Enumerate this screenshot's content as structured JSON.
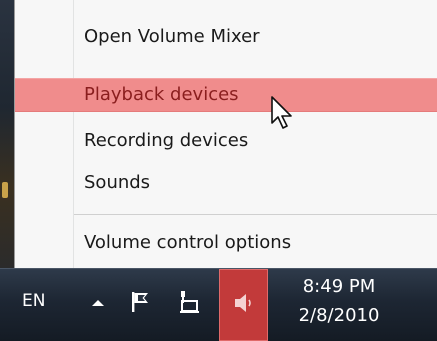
{
  "context_menu": {
    "items": [
      {
        "label": "Open Volume Mixer",
        "highlighted": false
      },
      {
        "label": "Playback devices",
        "highlighted": true
      },
      {
        "label": "Recording devices",
        "highlighted": false
      },
      {
        "label": "Sounds",
        "highlighted": false
      },
      {
        "label": "Volume control options",
        "highlighted": false
      }
    ],
    "highlight_color": "#f08c8c"
  },
  "taskbar": {
    "language": "EN",
    "tray_icons": [
      "show-hidden-icons-arrow",
      "action-center-flag-icon",
      "network-icon",
      "speaker-volume-icon"
    ],
    "volume_button_color": "#c23a3a",
    "clock": {
      "time": "8:49 PM",
      "date": "2/8/2010"
    }
  }
}
